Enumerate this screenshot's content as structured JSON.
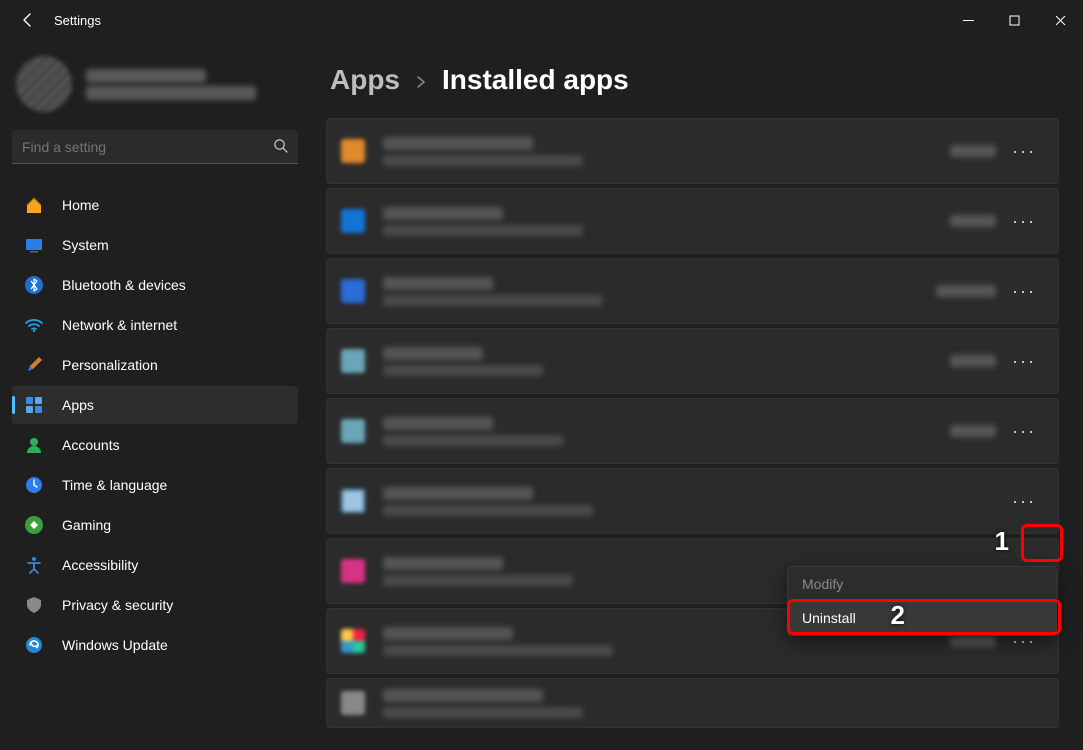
{
  "window": {
    "title": "Settings"
  },
  "sidebar": {
    "search_placeholder": "Find a setting",
    "items": [
      {
        "label": "Home"
      },
      {
        "label": "System"
      },
      {
        "label": "Bluetooth & devices"
      },
      {
        "label": "Network & internet"
      },
      {
        "label": "Personalization"
      },
      {
        "label": "Apps"
      },
      {
        "label": "Accounts"
      },
      {
        "label": "Time & language"
      },
      {
        "label": "Gaming"
      },
      {
        "label": "Accessibility"
      },
      {
        "label": "Privacy & security"
      },
      {
        "label": "Windows Update"
      }
    ],
    "selected_index": 5
  },
  "breadcrumb": {
    "root": "Apps",
    "leaf": "Installed apps"
  },
  "apps_row3_size": "",
  "context_menu": {
    "modify": "Modify",
    "uninstall": "Uninstall"
  },
  "annotations": {
    "callout_1": "1",
    "callout_2": "2"
  }
}
